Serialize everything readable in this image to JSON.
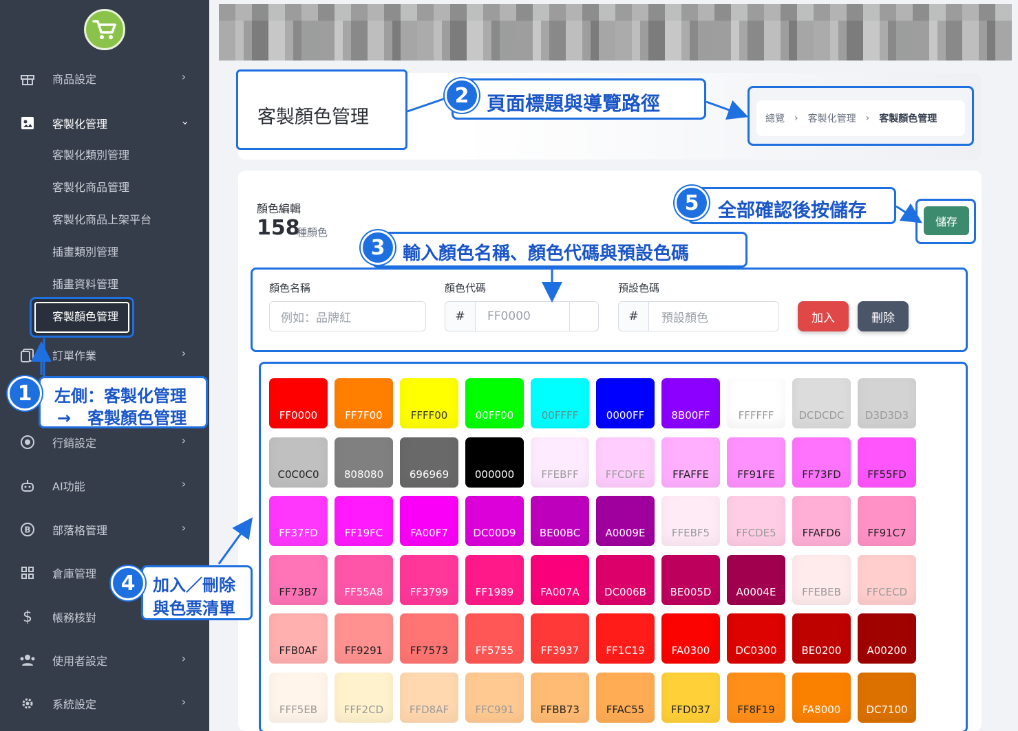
{
  "sidebar": {
    "items": [
      {
        "label": "商品設定",
        "icon": "gift-icon",
        "expandable": true
      },
      {
        "label": "客製化管理",
        "icon": "custom-icon",
        "expandable": true,
        "open": true
      },
      {
        "label": "訂單作業",
        "icon": "clipboard-icon",
        "expandable": true
      },
      {
        "label": "行銷設定",
        "icon": "target-icon",
        "expandable": true
      },
      {
        "label": "AI功能",
        "icon": "robot-icon",
        "expandable": true
      },
      {
        "label": "部落格管理",
        "icon": "blog-icon",
        "expandable": true
      },
      {
        "label": "倉庫管理",
        "icon": "warehouse-icon",
        "expandable": false
      },
      {
        "label": "帳務核對",
        "icon": "dollar-icon",
        "expandable": false
      },
      {
        "label": "使用者設定",
        "icon": "users-icon",
        "expandable": true
      },
      {
        "label": "系統設定",
        "icon": "gear-icon",
        "expandable": true
      }
    ],
    "sub_items": [
      "客製化類別管理",
      "客製化商品管理",
      "客製化商品上架平台",
      "插畫類別管理",
      "插畫資料管理"
    ],
    "active_sub": "客製顏色管理"
  },
  "page": {
    "title": "客製顏色管理",
    "breadcrumb": [
      "總覽",
      "客製化管理",
      "客製顏色管理"
    ]
  },
  "editor": {
    "heading": "顏色編輯",
    "count": "158",
    "count_unit": "種顏色",
    "save_label": "儲存",
    "fields": {
      "name_label": "顏色名稱",
      "name_placeholder": "例如：品牌紅",
      "code_label": "顏色代碼",
      "code_prefix": "#",
      "code_placeholder": "FF0000",
      "preset_label": "預設色碼",
      "preset_prefix": "#",
      "preset_placeholder": "預設顏色"
    },
    "add_label": "加入",
    "delete_label": "刪除"
  },
  "annotations": {
    "a1_num": "1",
    "a1_line1": "左側：客製化管理",
    "a1_line2": "→　客製顏色管理",
    "a2_num": "2",
    "a2_text": "頁面標題與導覽路徑",
    "a3_num": "3",
    "a3_text": "輸入顏色名稱、顏色代碼與預設色碼",
    "a4_num": "4",
    "a4_line1": "加入／刪除",
    "a4_line2": "與色票清單",
    "a5_num": "5",
    "a5_text": "全部確認後按儲存"
  },
  "colors": {
    "accent": "#1e6fe0",
    "sidebar_bg": "#353c4a",
    "save": "#3d8b6e",
    "add": "#e04848",
    "delete": "#4a5568"
  },
  "swatches": [
    "FF0000",
    "FF7F00",
    "FFFF00",
    "00FF00",
    "00FFFF",
    "0000FF",
    "8B00FF",
    "FFFFFF",
    "DCDCDC",
    "D3D3D3",
    "C0C0C0",
    "808080",
    "696969",
    "000000",
    "FFEBFF",
    "FFCDFE",
    "FFAFFE",
    "FF91FE",
    "FF73FD",
    "FF55FD",
    "FF37FD",
    "FF19FC",
    "FA00F7",
    "DC00D9",
    "BE00BC",
    "A0009E",
    "FFEBF5",
    "FFCDE5",
    "FFAFD6",
    "FF91C7",
    "FF73B7",
    "FF55A8",
    "FF3799",
    "FF1989",
    "FA007A",
    "DC006B",
    "BE005D",
    "A0004E",
    "FFEBEB",
    "FFCECD",
    "FFB0AF",
    "FF9291",
    "FF7573",
    "FF5755",
    "FF3937",
    "FF1C19",
    "FA0300",
    "DC0300",
    "BE0200",
    "A00200",
    "FFF5EB",
    "FFF2CD",
    "FFD8AF",
    "FFC991",
    "FFBB73",
    "FFAC55",
    "FFD037",
    "FF8F19",
    "FA8000",
    "DC7100"
  ]
}
